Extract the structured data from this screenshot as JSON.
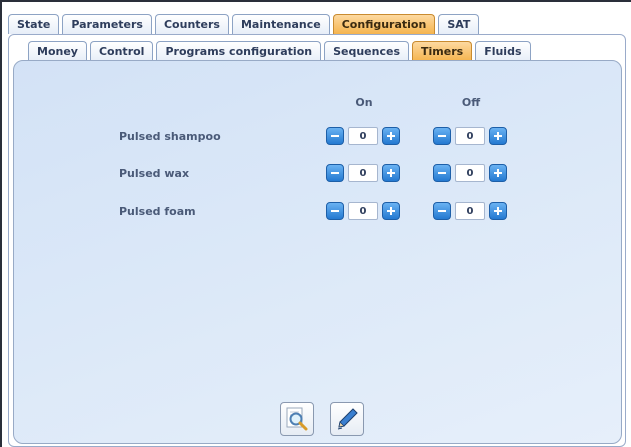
{
  "main_tabs": [
    {
      "label": "State"
    },
    {
      "label": "Parameters"
    },
    {
      "label": "Counters"
    },
    {
      "label": "Maintenance"
    },
    {
      "label": "Configuration",
      "active": true
    },
    {
      "label": "SAT"
    }
  ],
  "sub_tabs": [
    {
      "label": "Money"
    },
    {
      "label": "Control"
    },
    {
      "label": "Programs configuration"
    },
    {
      "label": "Sequences"
    },
    {
      "label": "Timers",
      "active": true
    },
    {
      "label": "Fluids"
    }
  ],
  "columns": {
    "on": "On",
    "off": "Off"
  },
  "rows": [
    {
      "label": "Pulsed shampoo",
      "on_value": "0",
      "off_value": "0"
    },
    {
      "label": "Pulsed wax",
      "on_value": "0",
      "off_value": "0"
    },
    {
      "label": "Pulsed foam",
      "on_value": "0",
      "off_value": "0"
    }
  ],
  "toolbar": {
    "search_icon": "magnifier-icon",
    "edit_icon": "pen-icon"
  },
  "colors": {
    "active_tab": "#f5b44e",
    "stepper_button": "#2479d1",
    "panel_background": "#d9e6f7"
  }
}
